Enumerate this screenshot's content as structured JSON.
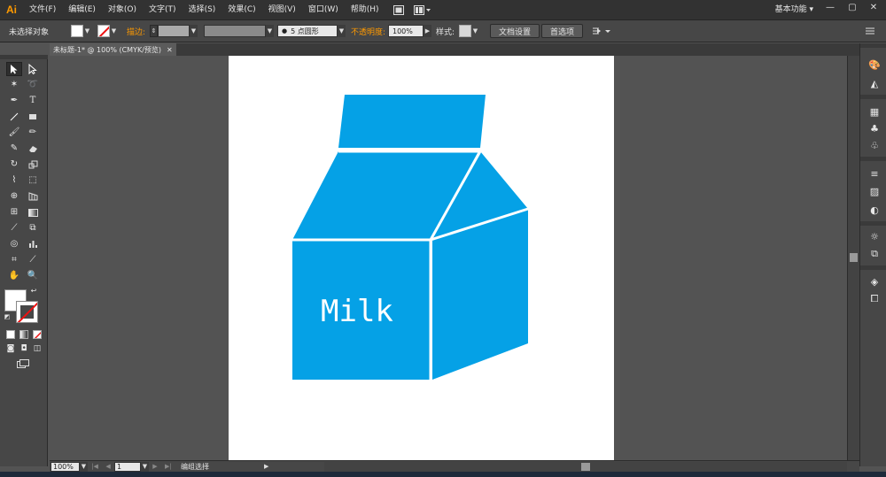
{
  "app": {
    "logo": "Ai"
  },
  "menubar": {
    "items": [
      "文件(F)",
      "编辑(E)",
      "对象(O)",
      "文字(T)",
      "选择(S)",
      "效果(C)",
      "视图(V)",
      "窗口(W)",
      "帮助(H)"
    ],
    "workspace": "基本功能",
    "workspace_arrow": "▾",
    "window_min": "—",
    "window_max": "▢",
    "window_close": "✕"
  },
  "controlbar": {
    "selection_status": "未选择对象",
    "stroke_label": "描边:",
    "brush_value": "5 点圆形",
    "brush_bullet": "●",
    "opacity_label": "不透明度:",
    "opacity_value": "100%",
    "style_label": "样式:",
    "doc_setup_button": "文档设置",
    "preferences_button": "首选项"
  },
  "document": {
    "tab_title": "未标题-1* @ 100% (CMYK/预览)",
    "tab_close": "✕"
  },
  "canvas": {
    "milk_text": "Milk",
    "fill_color": "#05a1e6",
    "outline_color": "#ffffff"
  },
  "statusbar": {
    "zoom": "100%",
    "page": "1",
    "status_text": "编组选择"
  },
  "colors": {
    "accent": "#ff9a00",
    "ui_dark": "#323232",
    "ui_panel": "#474747",
    "pasteboard": "#535353"
  }
}
